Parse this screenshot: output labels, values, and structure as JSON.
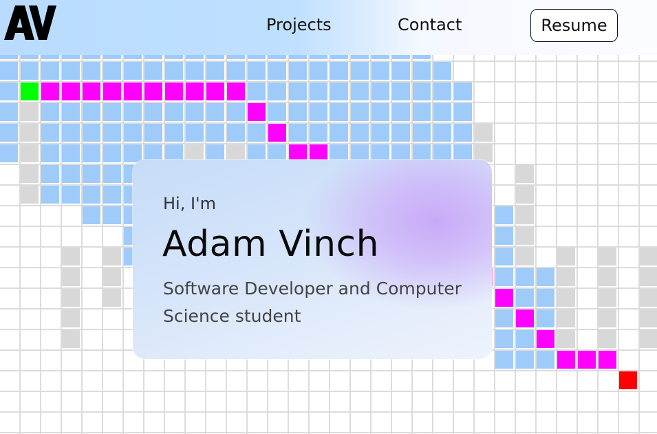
{
  "nav": {
    "logo_text": "AV",
    "projects_label": "Projects",
    "contact_label": "Contact",
    "resume_label": "Resume"
  },
  "hero": {
    "greeting": "Hi, I'm",
    "name": "Adam Vinch",
    "subtitle": "Software Developer and Computer Science student"
  },
  "colors": {
    "visited": "#9fcbfa",
    "path": "#ff00ff",
    "start": "#00ff00",
    "end": "#ff0000",
    "wall": "#d8d8d8",
    "grid_line": "#dcdcdc"
  },
  "icons": {
    "logo": "av-logo-icon"
  }
}
